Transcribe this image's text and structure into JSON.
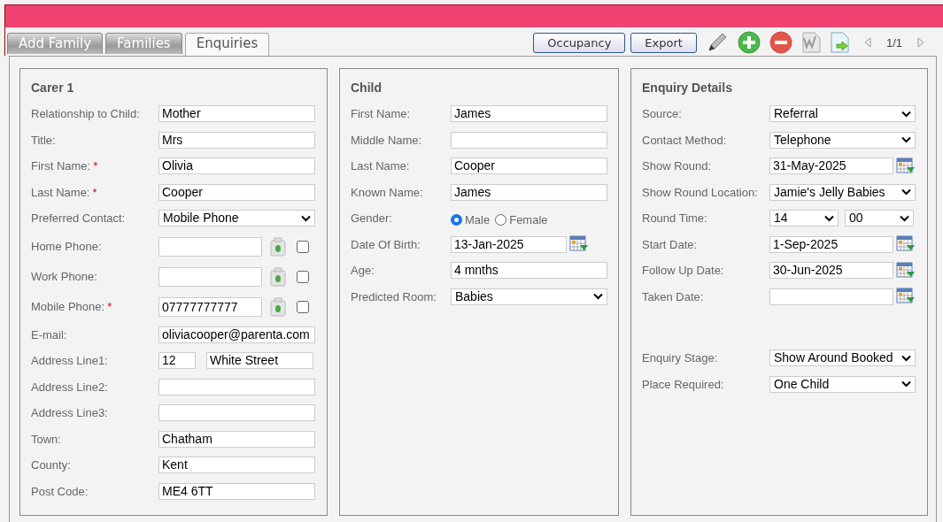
{
  "tabs": [
    {
      "label": "Add Family",
      "selected": false
    },
    {
      "label": "Families",
      "selected": false
    },
    {
      "label": "Enquiries",
      "selected": true
    }
  ],
  "toolbar": {
    "buttons": [
      "Occupancy",
      "Export"
    ],
    "page": "1/1"
  },
  "panels": [
    {
      "title": "Carer 1",
      "fields": [
        {
          "kind": "text",
          "label": "Relationship to Child:",
          "value": "Mother"
        },
        {
          "kind": "text",
          "label": "Title:",
          "value": "Mrs"
        },
        {
          "kind": "text",
          "label": "First Name:",
          "required_mark": "*",
          "value": "Olivia"
        },
        {
          "kind": "text",
          "label": "Last Name:",
          "required_mark": "*",
          "value": "Cooper"
        },
        {
          "kind": "select",
          "label": "Preferred Contact:",
          "value": "Mobile Phone"
        },
        {
          "kind": "phone",
          "label": "Home Phone:",
          "checked": false
        },
        {
          "kind": "phone",
          "label": "Work Phone:",
          "checked": false
        },
        {
          "kind": "phone",
          "label": "Mobile Phone:",
          "required_mark": "*",
          "value": "07777777777",
          "checked": false
        },
        {
          "kind": "text",
          "label": "E-mail:",
          "value": "oliviacooper@parenta.com"
        },
        {
          "kind": "address",
          "label": "Address Line1:",
          "number": "12",
          "street": "White Street"
        },
        {
          "kind": "text",
          "label": "Address Line2:"
        },
        {
          "kind": "text",
          "label": "Address Line3:"
        },
        {
          "kind": "text",
          "label": "Town:",
          "value": "Chatham"
        },
        {
          "kind": "text",
          "label": "County:",
          "value": "Kent"
        },
        {
          "kind": "text",
          "label": "Post Code:",
          "value": "ME4 6TT"
        }
      ]
    },
    {
      "title": "Child",
      "fields": [
        {
          "kind": "text",
          "label": "First Name:",
          "value": "James"
        },
        {
          "kind": "text",
          "label": "Middle Name:"
        },
        {
          "kind": "text",
          "label": "Last Name:",
          "value": "Cooper"
        },
        {
          "kind": "text",
          "label": "Known Name:",
          "value": "James"
        },
        {
          "kind": "radio",
          "label": "Gender:",
          "options": [
            {
              "label": "Male",
              "selected": true
            },
            {
              "label": "Female",
              "selected": false
            }
          ]
        },
        {
          "kind": "date",
          "label": "Date Of Birth:",
          "value": "13-Jan-2025"
        },
        {
          "kind": "text",
          "label": "Age:",
          "value": "4 mnths"
        },
        {
          "kind": "select",
          "label": "Predicted Room:",
          "value": "Babies"
        }
      ]
    },
    {
      "title": "Enquiry Details",
      "fields": [
        {
          "kind": "select",
          "label": "Source:",
          "value": "Referral"
        },
        {
          "kind": "select",
          "label": "Contact Method:",
          "value": "Telephone"
        },
        {
          "kind": "date",
          "label": "Show Round:",
          "value": "31-May-2025"
        },
        {
          "kind": "select",
          "label": "Show Round Location:",
          "value": "Jamie's Jelly Babies"
        },
        {
          "kind": "time",
          "label": "Round Time:",
          "hour": "14",
          "minute": "00"
        },
        {
          "kind": "date",
          "label": "Start Date:",
          "value": "1-Sep-2025"
        },
        {
          "kind": "date",
          "label": "Follow Up Date:",
          "value": "30-Jun-2025"
        },
        {
          "kind": "date",
          "label": "Taken Date:"
        }
      ],
      "extra_fields": [
        {
          "kind": "select",
          "label": "Enquiry Stage:",
          "value": "Show Around Booked"
        },
        {
          "kind": "select",
          "label": "Place Required:",
          "value": "One Child"
        }
      ]
    }
  ]
}
